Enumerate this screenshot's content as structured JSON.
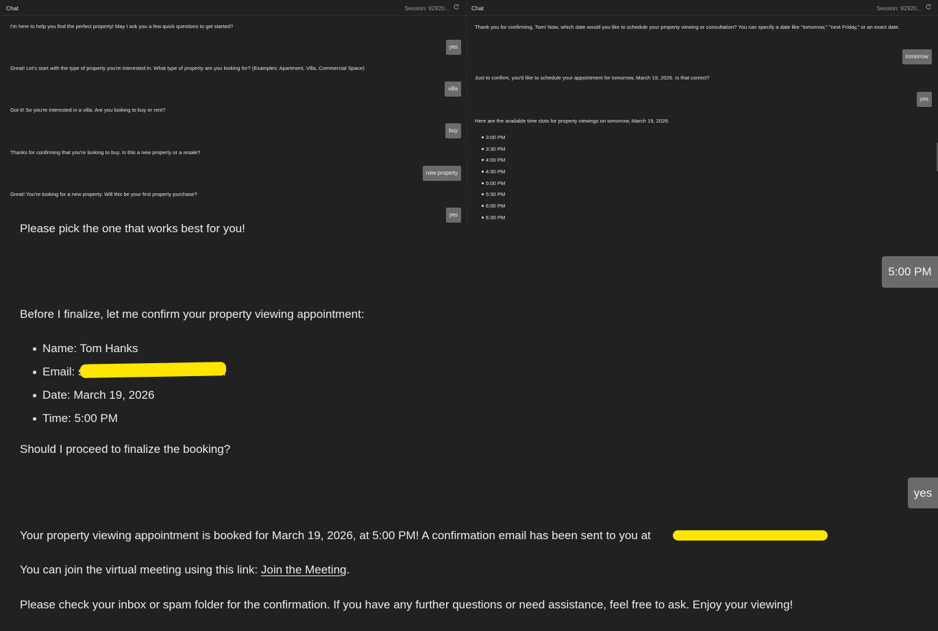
{
  "left_panel": {
    "title": "Chat",
    "session": "Session: 92920...",
    "messages": [
      {
        "role": "assistant",
        "text": "I'm here to help you find the perfect property! May I ask you a few quick questions to get started?"
      },
      {
        "role": "user",
        "text": "yes"
      },
      {
        "role": "assistant",
        "text": "Great! Let's start with the type of property you're interested in. What type of property are you looking for? (Examples: Apartment, Villa, Commercial Space)"
      },
      {
        "role": "user",
        "text": "villa"
      },
      {
        "role": "assistant",
        "text": "Got it! So you're interested in a villa. Are you looking to buy or rent?"
      },
      {
        "role": "user",
        "text": "buy"
      },
      {
        "role": "assistant",
        "text": "Thanks for confirming that you're looking to buy. Is this a new property or a resale?"
      },
      {
        "role": "user",
        "text": "new property"
      },
      {
        "role": "assistant",
        "text": "Great! You're looking for a new property. Will this be your first property purchase?"
      },
      {
        "role": "user",
        "text": "yes"
      }
    ]
  },
  "right_panel": {
    "title": "Chat",
    "session": "Session: 92920...",
    "messages": [
      {
        "role": "assistant",
        "text": "Thank you for confirming, Tom! Now, which date would you like to schedule your property viewing or consultation? You can specify a date like \"tomorrow,\" \"next Friday,\" or an exact date."
      },
      {
        "role": "user",
        "text": "tomorrow"
      },
      {
        "role": "assistant",
        "text": "Just to confirm, you'd like to schedule your appointment for tomorrow, March 19, 2026. Is that correct?"
      },
      {
        "role": "user",
        "text": "yes"
      },
      {
        "role": "assistant",
        "text": "Here are the available time slots for property viewings on tomorrow, March 19, 2026:"
      }
    ],
    "time_slots": [
      "3:00 PM",
      "3:30 PM",
      "4:00 PM",
      "4:30 PM",
      "5:00 PM",
      "5:30 PM",
      "6:00 PM",
      "6:30 PM"
    ]
  },
  "main": {
    "pick_prompt": "Please pick the one that works best for you!",
    "user_time": "5:00 PM",
    "confirm_intro": "Before I finalize, let me confirm your property viewing appointment:",
    "details": {
      "name": "Name: Tom Hanks",
      "email_label": "Email: s",
      "email_tail": "com",
      "date": "Date: March 19, 2026",
      "time": "Time: 5:00 PM"
    },
    "proceed_question": "Should I proceed to finalize the booking?",
    "user_yes": "yes",
    "booked_text": "Your property viewing appointment is booked for March 19, 2026, at 5:00 PM! A confirmation email has been sent to you at",
    "join_prefix": "You can join the virtual meeting using this link: ",
    "join_link": "Join the Meeting",
    "join_suffix": ".",
    "closing": "Please check your inbox or spam folder for the confirmation. If you have any further questions or need assistance, feel free to ask. Enjoy your viewing!"
  },
  "colors": {
    "background": "#212121",
    "user_bubble": "#6b6b6b",
    "redaction": "#ffe600",
    "text": "#ececec"
  },
  "icons": {
    "panel_action": "refresh-icon"
  }
}
